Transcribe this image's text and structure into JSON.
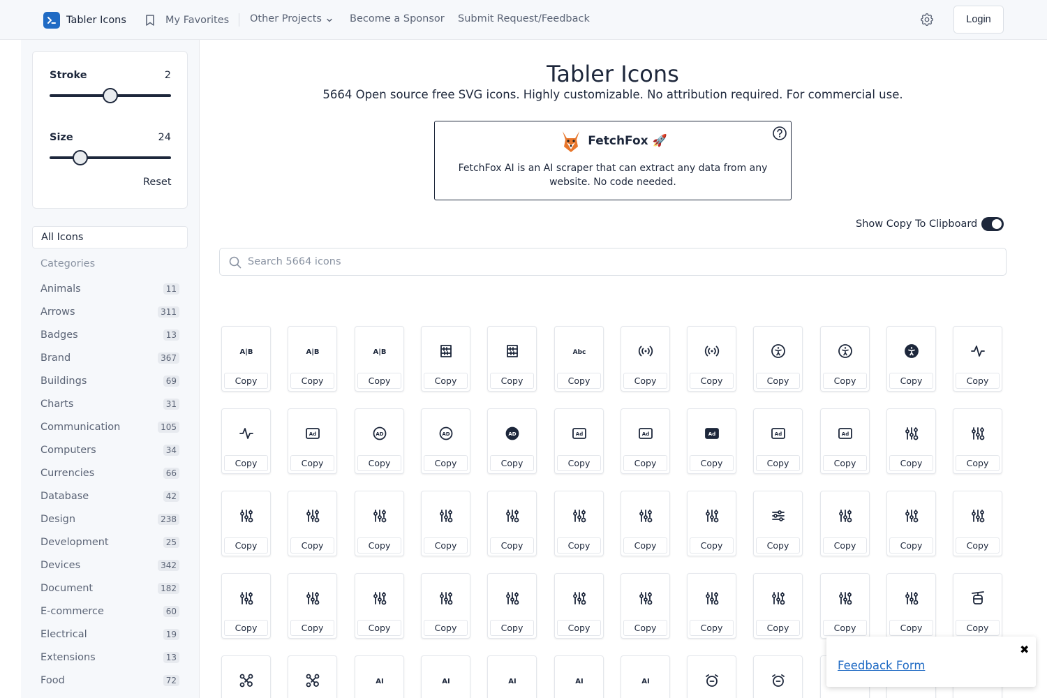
{
  "nav": {
    "brand": "Tabler Icons",
    "favorites": "My Favorites",
    "other_projects": "Other Projects",
    "sponsor": "Become a Sponsor",
    "feedback": "Submit Request/Feedback",
    "login": "Login",
    "icons": {
      "logo": "terminal-icon",
      "favorites": "bookmark-icon",
      "projects": "chevron-down-icon",
      "settings": "gear-icon"
    }
  },
  "controls": {
    "stroke_label": "Stroke",
    "stroke_value": "2",
    "stroke_level": 0.5,
    "size_label": "Size",
    "size_value": "24",
    "size_level": 0.22,
    "reset": "Reset"
  },
  "sidebar": {
    "all_icons": "All Icons",
    "categories_heading": "Categories",
    "categories": [
      {
        "name": "Animals",
        "count": "11"
      },
      {
        "name": "Arrows",
        "count": "311"
      },
      {
        "name": "Badges",
        "count": "13"
      },
      {
        "name": "Brand",
        "count": "367"
      },
      {
        "name": "Buildings",
        "count": "69"
      },
      {
        "name": "Charts",
        "count": "31"
      },
      {
        "name": "Communication",
        "count": "105"
      },
      {
        "name": "Computers",
        "count": "34"
      },
      {
        "name": "Currencies",
        "count": "66"
      },
      {
        "name": "Database",
        "count": "42"
      },
      {
        "name": "Design",
        "count": "238"
      },
      {
        "name": "Development",
        "count": "25"
      },
      {
        "name": "Devices",
        "count": "342"
      },
      {
        "name": "Document",
        "count": "182"
      },
      {
        "name": "E-commerce",
        "count": "60"
      },
      {
        "name": "Electrical",
        "count": "19"
      },
      {
        "name": "Extensions",
        "count": "13"
      },
      {
        "name": "Food",
        "count": "72"
      }
    ]
  },
  "hero": {
    "title": "Tabler Icons",
    "subtitle": "5664 Open source free SVG icons. Highly customizable. No attribution required. For commercial use."
  },
  "ad": {
    "name": "FetchFox 🚀",
    "description": "FetchFox AI is an AI scraper that can extract any data from any website. No code needed.",
    "logo_icon": "fox-icon",
    "help_icon": "question-circle-icon"
  },
  "toggle": {
    "label": "Show Copy To Clipboard",
    "on": true
  },
  "search": {
    "placeholder": "Search 5664 icons",
    "value": ""
  },
  "copy_label": "Copy",
  "icons": [
    [
      "a-b-2-icon",
      "a-b-off-icon",
      "a-b-icon",
      "abacus-off-icon",
      "abacus-icon",
      "abc-icon",
      "access-point-off-icon",
      "access-point-icon",
      "accessible-off-icon",
      "accessible-icon",
      "accessible-filled-icon",
      "activity-heartbeat-icon"
    ],
    [
      "activity-icon",
      "ad-2-icon",
      "ad-circle-off-icon",
      "ad-circle-icon",
      "ad-circle-filled-icon",
      "ad-off-icon",
      "ad-icon",
      "ad-filled-icon",
      "address-book-off-icon",
      "address-book-icon",
      "adjustments-icon",
      "adjustments-bolt-icon"
    ],
    [
      "adjustments-cancel-icon",
      "adjustments-check-icon",
      "adjustments-code-icon",
      "adjustments-cog-icon",
      "adjustments-dollar-icon",
      "adjustments-down-icon",
      "adjustments-exclamation-icon",
      "adjustments-heart-icon",
      "adjustments-horizontal-icon",
      "adjustments-minus-icon",
      "adjustments-off-icon",
      "adjustments-pause-icon"
    ],
    [
      "adjustments-pin-icon",
      "adjustments-plus-icon",
      "adjustments-question-icon",
      "adjustments-search-icon",
      "adjustments-share-icon",
      "adjustments-spark-icon",
      "adjustments-star-icon",
      "adjustments-up-icon",
      "adjustments-x-icon",
      "adjustments-alt-icon",
      "adjustments-filled-icon",
      "aerial-lift-icon"
    ],
    [
      "affiliate-icon",
      "affiliate-filled-icon",
      "ai-icon",
      "air-balloon-icon",
      "air-conditioning-disabled-icon",
      "air-conditioning-icon",
      "air-traffic-control-icon",
      "alarm-average-icon",
      "alarm-minus-icon",
      "alarm-off-icon",
      "alarm-plus-icon",
      "alarm-icon"
    ]
  ],
  "feedback_popup": {
    "link": "Feedback Form",
    "close": "✖"
  }
}
